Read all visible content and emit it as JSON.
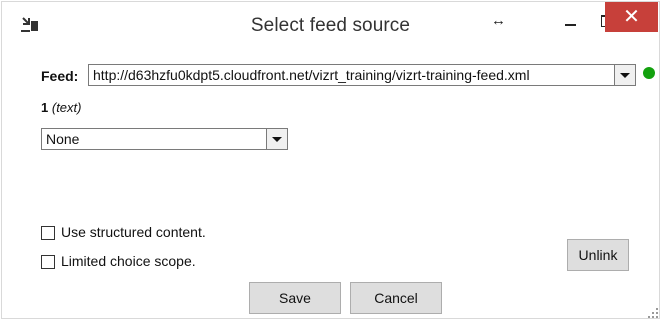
{
  "window": {
    "title": "Select feed source",
    "resize_symbol": "↔",
    "close_symbol": "✕"
  },
  "feed": {
    "label": "Feed:",
    "value": "http://d63hzfu0kdpt5.cloudfront.net/vizrt_training/vizrt-training-feed.xml",
    "status_color": "#13a10e"
  },
  "field": {
    "number": "1",
    "type": "(text)",
    "selected": "None"
  },
  "options": {
    "structured": "Use structured content.",
    "limited": "Limited choice scope."
  },
  "buttons": {
    "unlink": "Unlink",
    "save": "Save",
    "cancel": "Cancel"
  },
  "colors": {
    "close_bg": "#c7403a",
    "button_bg": "#dedede"
  }
}
